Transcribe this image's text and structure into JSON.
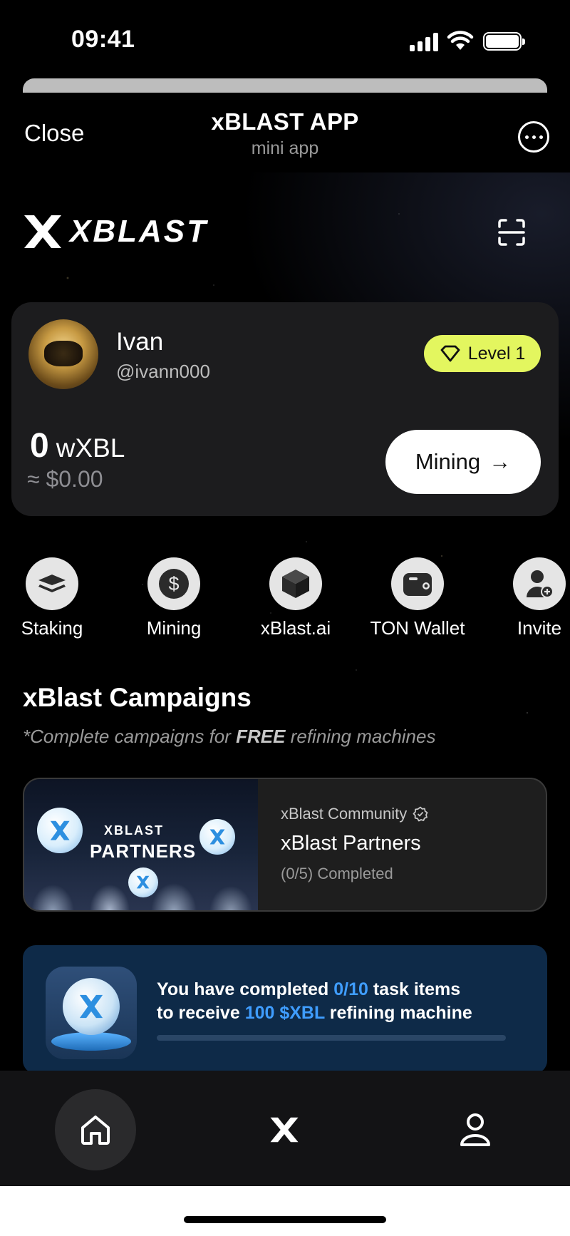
{
  "status_bar": {
    "time": "09:41"
  },
  "mini_app": {
    "close_label": "Close",
    "title": "xBLAST APP",
    "subtitle": "mini app"
  },
  "brand": {
    "logo_text": "XBLAST"
  },
  "profile": {
    "name": "Ivan",
    "handle": "@ivann000",
    "level": "Level 1",
    "balance_amount": "0",
    "balance_unit": "wXBL",
    "balance_usd": "≈ $0.00",
    "mining_label": "Mining",
    "mining_arrow": "→",
    "level_color": "#e3f65f"
  },
  "actions": [
    {
      "label": "Staking",
      "icon": "layers-icon"
    },
    {
      "label": "Mining",
      "icon": "dollar-icon"
    },
    {
      "label": "xBlast.ai",
      "icon": "cube-icon"
    },
    {
      "label": "TON Wallet",
      "icon": "wallet-icon"
    },
    {
      "label": "Invite",
      "icon": "add-user-icon"
    }
  ],
  "campaigns": {
    "title": "xBlast Campaigns",
    "subtitle_prefix": "*Complete campaigns for ",
    "subtitle_emphasis": "FREE",
    "subtitle_suffix": " refining machines",
    "card": {
      "image_brand": "XBLAST",
      "image_title": "PARTNERS",
      "source": "xBlast Community",
      "name": "xBlast Partners",
      "progress": "(0/5) Completed"
    }
  },
  "task_banner": {
    "line1_prefix": "You have completed ",
    "line1_highlight": "0/10",
    "line1_suffix": " task items",
    "line2_prefix": "to receive ",
    "line2_highlight": "100 $XBL",
    "line2_suffix": " refining machine",
    "progress_fraction": 0,
    "accent_color": "#3f9dff"
  },
  "bottom_nav": [
    {
      "name": "home",
      "icon": "home-icon",
      "active": true
    },
    {
      "name": "xblast",
      "icon": "x-logo-icon",
      "active": false
    },
    {
      "name": "profile",
      "icon": "user-icon",
      "active": false
    }
  ]
}
